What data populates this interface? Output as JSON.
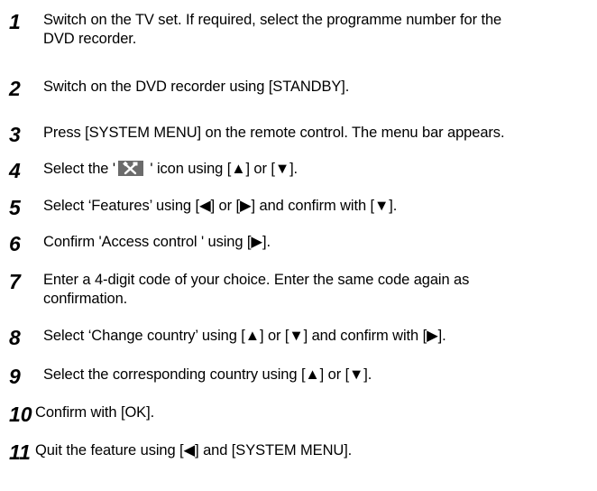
{
  "steps": [
    {
      "number": "1",
      "lines": [
        "Switch on the TV set. If required, select the programme number for the",
        "DVD recorder."
      ]
    },
    {
      "number": "2",
      "lines": [
        "Switch on the DVD recorder using [STANDBY]."
      ]
    },
    {
      "number": "3",
      "lines": [
        "Press [SYSTEM MENU] on the remote control. The menu bar appears."
      ]
    },
    {
      "number": "4",
      "before_icon": "Select the '",
      "icon": "tools-icon",
      "after_icon": " ' icon using [▲] or [▼]."
    },
    {
      "number": "5",
      "lines": [
        "Select ‘Features’ using [◀] or [▶] and confirm with [▼]."
      ]
    },
    {
      "number": "6",
      "lines": [
        "Confirm 'Access control ' using [▶]."
      ]
    },
    {
      "number": "7",
      "lines": [
        "Enter a 4-digit code of your choice. Enter the same code again as",
        "confirmation."
      ]
    },
    {
      "number": "8",
      "lines": [
        "Select ‘Change country’ using [▲] or [▼] and confirm with [▶]."
      ]
    },
    {
      "number": "9",
      "lines": [
        "Select the corresponding country using [▲] or [▼]."
      ]
    },
    {
      "number": "10",
      "lines": [
        "Confirm with [OK]."
      ]
    },
    {
      "number": "11",
      "lines": [
        "Quit the feature using [◀] and [SYSTEM MENU]."
      ]
    }
  ],
  "colors": {
    "text": "#000000",
    "icon_background": "#6b6b6b",
    "icon_foreground": "#ffffff"
  }
}
